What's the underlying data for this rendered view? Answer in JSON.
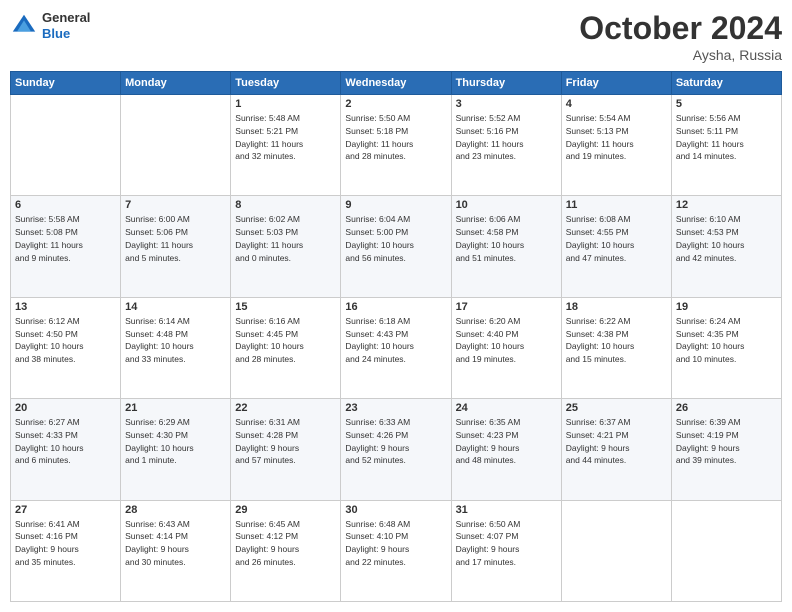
{
  "logo": {
    "general": "General",
    "blue": "Blue"
  },
  "title": {
    "month": "October 2024",
    "location": "Aysha, Russia"
  },
  "header": {
    "days": [
      "Sunday",
      "Monday",
      "Tuesday",
      "Wednesday",
      "Thursday",
      "Friday",
      "Saturday"
    ]
  },
  "weeks": [
    [
      {
        "day": "",
        "info": ""
      },
      {
        "day": "",
        "info": ""
      },
      {
        "day": "1",
        "info": "Sunrise: 5:48 AM\nSunset: 5:21 PM\nDaylight: 11 hours\nand 32 minutes."
      },
      {
        "day": "2",
        "info": "Sunrise: 5:50 AM\nSunset: 5:18 PM\nDaylight: 11 hours\nand 28 minutes."
      },
      {
        "day": "3",
        "info": "Sunrise: 5:52 AM\nSunset: 5:16 PM\nDaylight: 11 hours\nand 23 minutes."
      },
      {
        "day": "4",
        "info": "Sunrise: 5:54 AM\nSunset: 5:13 PM\nDaylight: 11 hours\nand 19 minutes."
      },
      {
        "day": "5",
        "info": "Sunrise: 5:56 AM\nSunset: 5:11 PM\nDaylight: 11 hours\nand 14 minutes."
      }
    ],
    [
      {
        "day": "6",
        "info": "Sunrise: 5:58 AM\nSunset: 5:08 PM\nDaylight: 11 hours\nand 9 minutes."
      },
      {
        "day": "7",
        "info": "Sunrise: 6:00 AM\nSunset: 5:06 PM\nDaylight: 11 hours\nand 5 minutes."
      },
      {
        "day": "8",
        "info": "Sunrise: 6:02 AM\nSunset: 5:03 PM\nDaylight: 11 hours\nand 0 minutes."
      },
      {
        "day": "9",
        "info": "Sunrise: 6:04 AM\nSunset: 5:00 PM\nDaylight: 10 hours\nand 56 minutes."
      },
      {
        "day": "10",
        "info": "Sunrise: 6:06 AM\nSunset: 4:58 PM\nDaylight: 10 hours\nand 51 minutes."
      },
      {
        "day": "11",
        "info": "Sunrise: 6:08 AM\nSunset: 4:55 PM\nDaylight: 10 hours\nand 47 minutes."
      },
      {
        "day": "12",
        "info": "Sunrise: 6:10 AM\nSunset: 4:53 PM\nDaylight: 10 hours\nand 42 minutes."
      }
    ],
    [
      {
        "day": "13",
        "info": "Sunrise: 6:12 AM\nSunset: 4:50 PM\nDaylight: 10 hours\nand 38 minutes."
      },
      {
        "day": "14",
        "info": "Sunrise: 6:14 AM\nSunset: 4:48 PM\nDaylight: 10 hours\nand 33 minutes."
      },
      {
        "day": "15",
        "info": "Sunrise: 6:16 AM\nSunset: 4:45 PM\nDaylight: 10 hours\nand 28 minutes."
      },
      {
        "day": "16",
        "info": "Sunrise: 6:18 AM\nSunset: 4:43 PM\nDaylight: 10 hours\nand 24 minutes."
      },
      {
        "day": "17",
        "info": "Sunrise: 6:20 AM\nSunset: 4:40 PM\nDaylight: 10 hours\nand 19 minutes."
      },
      {
        "day": "18",
        "info": "Sunrise: 6:22 AM\nSunset: 4:38 PM\nDaylight: 10 hours\nand 15 minutes."
      },
      {
        "day": "19",
        "info": "Sunrise: 6:24 AM\nSunset: 4:35 PM\nDaylight: 10 hours\nand 10 minutes."
      }
    ],
    [
      {
        "day": "20",
        "info": "Sunrise: 6:27 AM\nSunset: 4:33 PM\nDaylight: 10 hours\nand 6 minutes."
      },
      {
        "day": "21",
        "info": "Sunrise: 6:29 AM\nSunset: 4:30 PM\nDaylight: 10 hours\nand 1 minute."
      },
      {
        "day": "22",
        "info": "Sunrise: 6:31 AM\nSunset: 4:28 PM\nDaylight: 9 hours\nand 57 minutes."
      },
      {
        "day": "23",
        "info": "Sunrise: 6:33 AM\nSunset: 4:26 PM\nDaylight: 9 hours\nand 52 minutes."
      },
      {
        "day": "24",
        "info": "Sunrise: 6:35 AM\nSunset: 4:23 PM\nDaylight: 9 hours\nand 48 minutes."
      },
      {
        "day": "25",
        "info": "Sunrise: 6:37 AM\nSunset: 4:21 PM\nDaylight: 9 hours\nand 44 minutes."
      },
      {
        "day": "26",
        "info": "Sunrise: 6:39 AM\nSunset: 4:19 PM\nDaylight: 9 hours\nand 39 minutes."
      }
    ],
    [
      {
        "day": "27",
        "info": "Sunrise: 6:41 AM\nSunset: 4:16 PM\nDaylight: 9 hours\nand 35 minutes."
      },
      {
        "day": "28",
        "info": "Sunrise: 6:43 AM\nSunset: 4:14 PM\nDaylight: 9 hours\nand 30 minutes."
      },
      {
        "day": "29",
        "info": "Sunrise: 6:45 AM\nSunset: 4:12 PM\nDaylight: 9 hours\nand 26 minutes."
      },
      {
        "day": "30",
        "info": "Sunrise: 6:48 AM\nSunset: 4:10 PM\nDaylight: 9 hours\nand 22 minutes."
      },
      {
        "day": "31",
        "info": "Sunrise: 6:50 AM\nSunset: 4:07 PM\nDaylight: 9 hours\nand 17 minutes."
      },
      {
        "day": "",
        "info": ""
      },
      {
        "day": "",
        "info": ""
      }
    ]
  ]
}
